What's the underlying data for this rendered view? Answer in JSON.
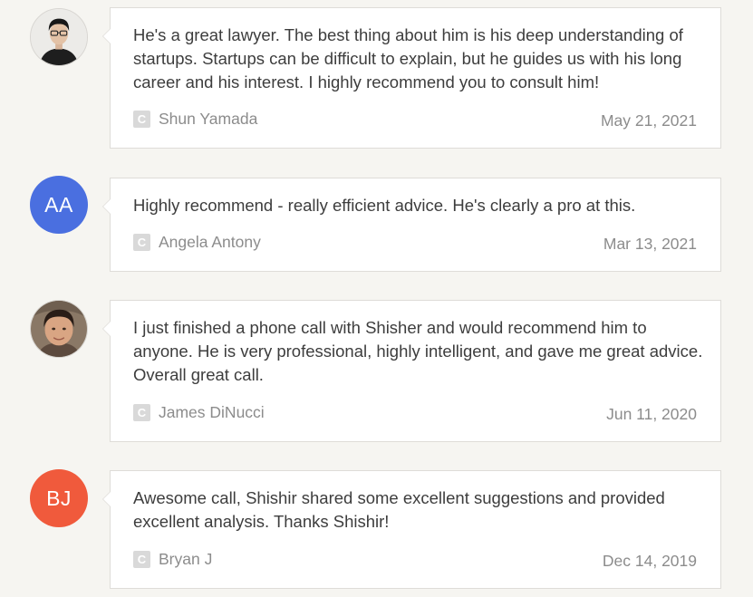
{
  "reviews": [
    {
      "avatar_type": "photo",
      "avatar_icon": "person-photo-icon",
      "text": "He's a great lawyer. The best thing about him is his deep understanding of startups. Startups can be difficult to explain, but he guides us with his long career and his interest. I highly recommend you to consult him!",
      "badge": "C",
      "author": "Shun Yamada",
      "date": "May 21, 2021"
    },
    {
      "avatar_type": "initials",
      "initials": "AA",
      "avatar_color": "#4a6fe0",
      "text": "Highly recommend - really efficient advice. He's clearly a pro at this.",
      "badge": "C",
      "author": "Angela Antony",
      "date": "Mar 13, 2021"
    },
    {
      "avatar_type": "photo",
      "avatar_icon": "person-photo-icon",
      "text": "I just finished a phone call with Shisher and would recommend him to anyone. He is very professional, highly intelligent, and gave me great advice. Overall great call.",
      "badge": "C",
      "author": "James DiNucci",
      "date": "Jun 11, 2020"
    },
    {
      "avatar_type": "initials",
      "initials": "BJ",
      "avatar_color": "#f05a3c",
      "text": "Awesome call, Shishir shared some excellent suggestions and provided excellent analysis. Thanks Shishir!",
      "badge": "C",
      "author": "Bryan J",
      "date": "Dec 14, 2019"
    }
  ]
}
